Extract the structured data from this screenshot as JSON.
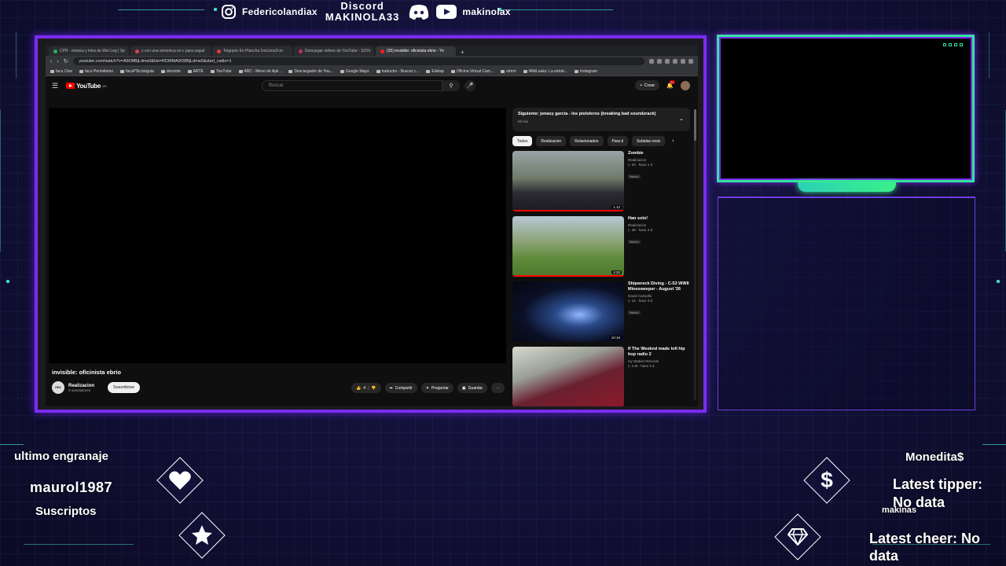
{
  "social": {
    "instagram_handle": "Federicolandiax",
    "discord_label": "Discord",
    "discord_handle": "MAKINOLA33",
    "youtube_handle": "makinolax"
  },
  "browser": {
    "tabs": [
      {
        "label": "CPR - música y letra de Wet Leg | Sp",
        "color": "#1db954"
      },
      {
        "label": "y con una armonica en c para seguir",
        "color": "#e04040"
      },
      {
        "label": "Telgopor En Plancha 1mx1mx2cm",
        "color": "#e04040"
      },
      {
        "label": "Descargar videos de YouTube - SSYo",
        "color": "#c03060"
      },
      {
        "label": "(35) invisible: oficinista ebrio - Yo",
        "color": "#ff2020"
      }
    ],
    "url": "youtube.com/watch?v=A9O8BjLdms0&list=RDMMA9O8BjLdms0&start_radio=1",
    "bookmarks": [
      "facu Cine",
      "facu Periodismo",
      "facuPSicologuia",
      "docente",
      "ARTE",
      "YouTube",
      "ABC - Menú de Apli...",
      "Descargador de You...",
      "Google Maps",
      "traductor - Buscar c...",
      "Edelap",
      "Oficina Virtual Cam...",
      "strem",
      "WikiLeaks: La estrat...",
      "Instagram"
    ]
  },
  "youtube": {
    "logo": "YouTube",
    "region": "AR",
    "search_placeholder": "Buscar",
    "create_label": "Crear",
    "notif_count": "9+",
    "video_title": "invisible: oficinista ebrio",
    "channel_name": "Realizacion",
    "channel_avatar_text": "REA",
    "subscribers": "3 suscriptores",
    "subscribe_label": "Suscribirse",
    "likes": "4",
    "share_label": "Compartir",
    "ask_label": "Preguntar",
    "save_label": "Guardar",
    "playlist_next": "Siguiente: jonasy garcia - los pistoleros (breaking bad soundzrack)",
    "playlist_sub": "Mi mix",
    "chips": [
      "Todos",
      "Realizacion",
      "Relacionados",
      "Para ti",
      "Subidas recie"
    ],
    "recommendations": [
      {
        "title": "Zombie",
        "channel": "Realizacion",
        "views": "20",
        "ago": "hace 1 d",
        "badge": "Nuevo",
        "duration": "1:12"
      },
      {
        "title": "Han solo!",
        "channel": "Realizacion",
        "views": "38",
        "ago": "hace 4 d",
        "badge": "Nuevo",
        "duration": "4:20"
      },
      {
        "title": "Shipwreck Diving - C-53 WWII Minesweeper - August '26",
        "channel": "David Campillo",
        "views": "12",
        "ago": "hace 3 d",
        "badge": "Nuevo",
        "duration": "10:16"
      },
      {
        "title": "If The Weeknd made lofi hip hop radio 2",
        "channel": "Ivy Station Records",
        "views": "4 M",
        "ago": "hace 4 a",
        "badge": "",
        "duration": ""
      }
    ]
  },
  "widgets": {
    "follow_label": "ultimo engranaje",
    "follower_name": "maurol1987",
    "subs_label": "Suscriptos",
    "currency_label": "Monedita$",
    "tipper_label": "Latest tipper:",
    "tipper_value": "No data",
    "bits_label": "makinas",
    "cheer_label": "Latest cheer: No",
    "cheer_value": "data"
  },
  "colors": {
    "frame_purple": "#7a2cf0",
    "cam_green": "#33e3a0",
    "accent_teal": "#3fd7c4"
  }
}
